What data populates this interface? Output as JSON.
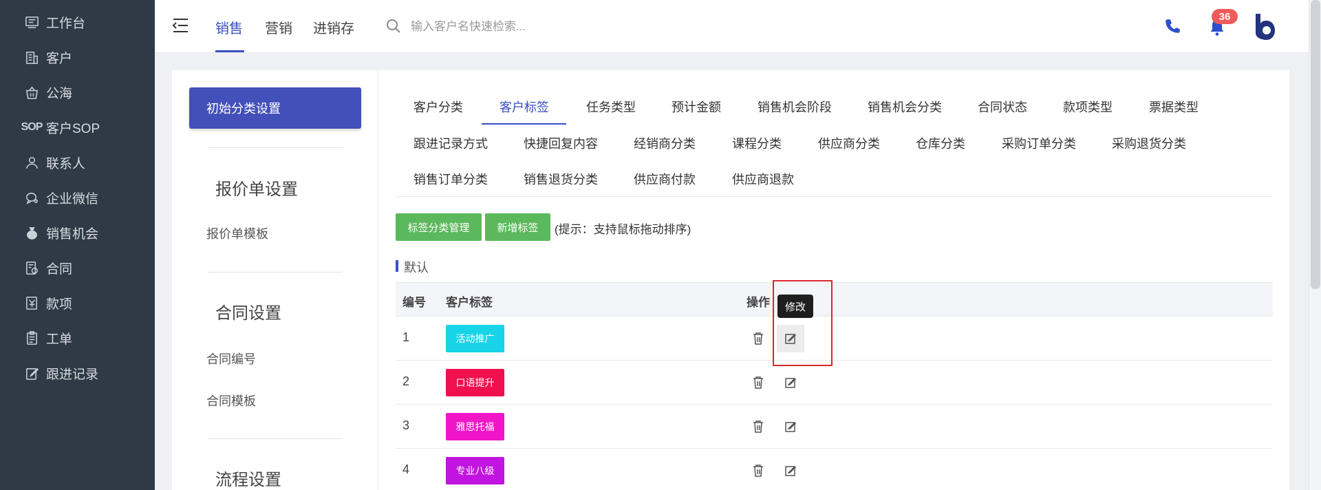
{
  "sidebar": {
    "items": [
      {
        "label": "工作台",
        "icon": "dashboard-icon"
      },
      {
        "label": "客户",
        "icon": "building-icon"
      },
      {
        "label": "公海",
        "icon": "basket-icon"
      },
      {
        "label": "客户SOP",
        "icon": "sop-icon",
        "icon_text": "SOP"
      },
      {
        "label": "联系人",
        "icon": "person-icon"
      },
      {
        "label": "企业微信",
        "icon": "chat-icon"
      },
      {
        "label": "销售机会",
        "icon": "money-bag-icon"
      },
      {
        "label": "合同",
        "icon": "contract-icon"
      },
      {
        "label": "款项",
        "icon": "yen-icon"
      },
      {
        "label": "工单",
        "icon": "clipboard-icon"
      },
      {
        "label": "跟进记录",
        "icon": "edit-note-icon"
      }
    ]
  },
  "topbar": {
    "nav": [
      "销售",
      "营销",
      "进销存"
    ],
    "active_nav": "销售",
    "search_placeholder": "输入客户名快速检索...",
    "notification_count": "36",
    "accent": "#3a50c4"
  },
  "left_panel": {
    "init_button": "初始分类设置",
    "sections": [
      {
        "title": "报价单设置",
        "links": [
          "报价单模板"
        ]
      },
      {
        "title": "合同设置",
        "links": [
          "合同编号",
          "合同模板"
        ]
      },
      {
        "title": "流程设置",
        "links": []
      }
    ]
  },
  "tabs": {
    "rows": [
      [
        "客户分类",
        "客户标签",
        "任务类型",
        "预计金额",
        "销售机会阶段",
        "销售机会分类",
        "合同状态",
        "款项类型",
        "票据类型"
      ],
      [
        "跟进记录方式",
        "快捷回复内容",
        "经销商分类",
        "课程分类",
        "供应商分类",
        "仓库分类",
        "采购订单分类",
        "采购退货分类"
      ],
      [
        "销售订单分类",
        "销售退货分类",
        "供应商付款",
        "供应商退款"
      ]
    ],
    "active": "客户标签"
  },
  "toolbar": {
    "manage_button": "标签分类管理",
    "add_button": "新增标签",
    "hint": "(提示：支持鼠标拖动排序)",
    "button_color": "#5cb85c"
  },
  "group": {
    "label": "默认"
  },
  "table": {
    "headers": {
      "num": "编号",
      "tag": "客户标签",
      "ops": "操作"
    },
    "rows": [
      {
        "num": "1",
        "tag": "活动推广",
        "color": "#17d4e8"
      },
      {
        "num": "2",
        "tag": "口语提升",
        "color": "#f0104e"
      },
      {
        "num": "3",
        "tag": "雅思托福",
        "color": "#f016c8"
      },
      {
        "num": "4",
        "tag": "专业八级",
        "color": "#c214e0"
      }
    ]
  },
  "tooltip": {
    "text": "修改"
  }
}
